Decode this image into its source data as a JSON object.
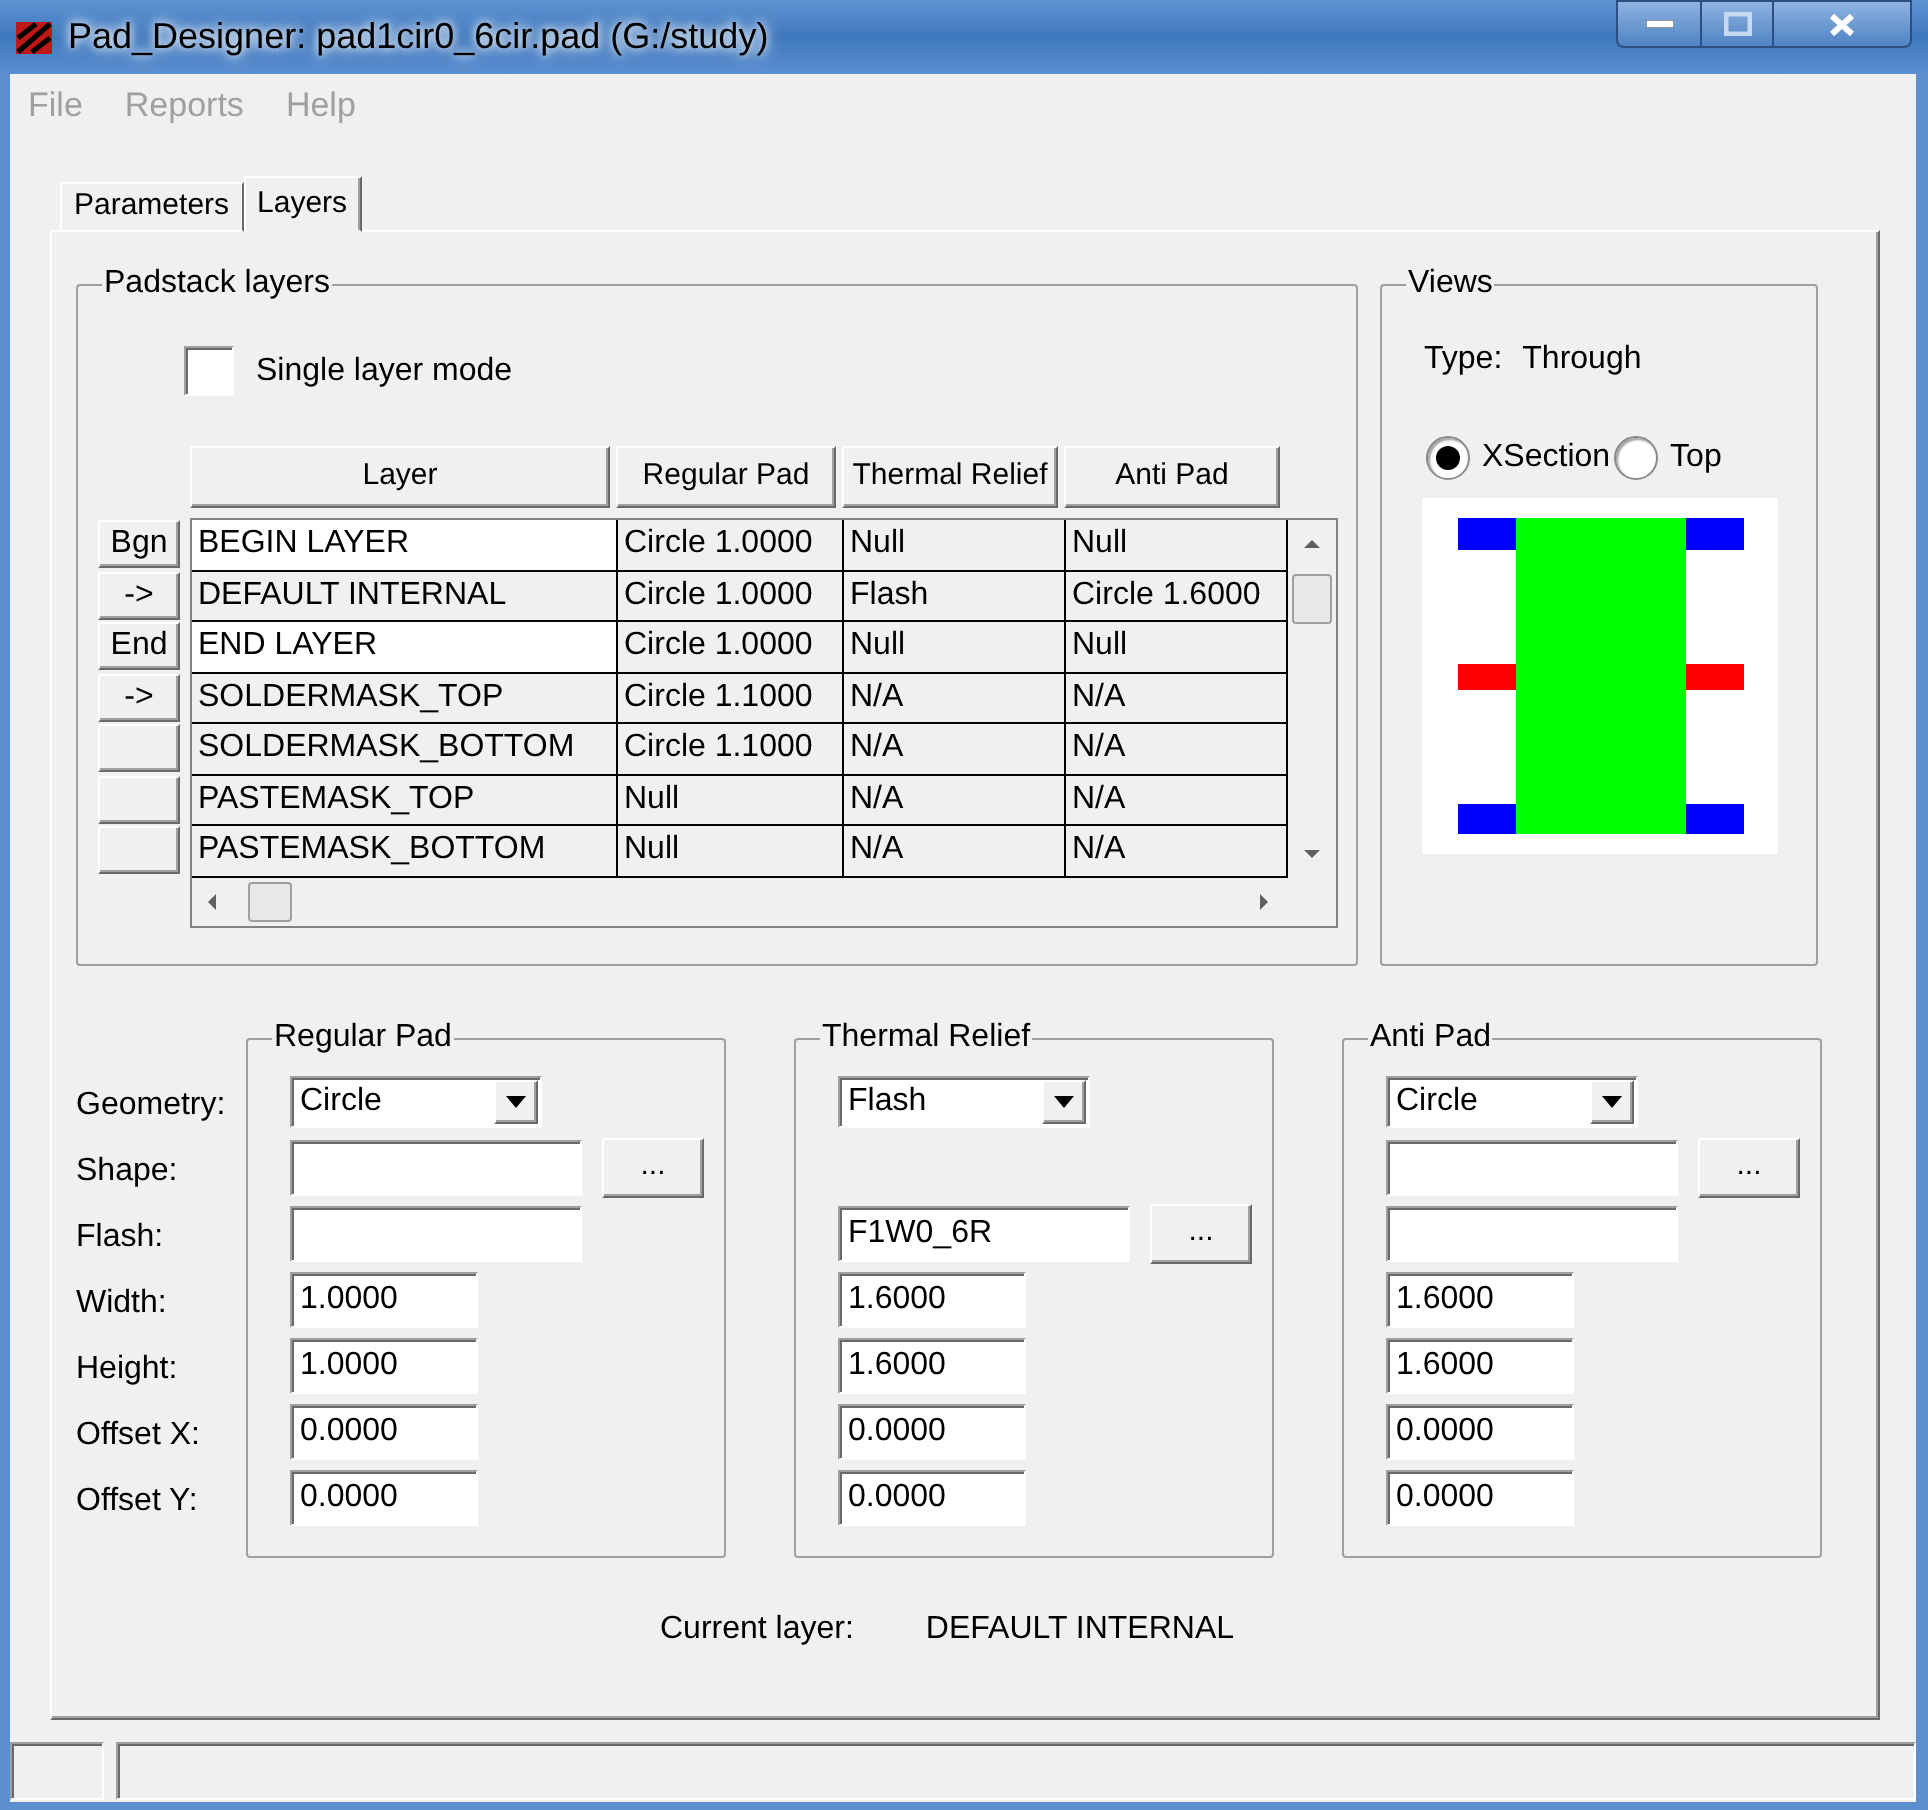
{
  "window": {
    "title": "Pad_Designer: pad1cir0_6cir.pad (G:/study)"
  },
  "menu": [
    {
      "label": "File",
      "disabled": true
    },
    {
      "label": "Reports",
      "disabled": true
    },
    {
      "label": "Help",
      "disabled": true
    }
  ],
  "tabs": [
    {
      "label": "Parameters",
      "selected": false
    },
    {
      "label": "Layers",
      "selected": true
    }
  ],
  "padstack_layers": {
    "title": "Padstack layers",
    "single_layer_mode": {
      "label": "Single layer mode",
      "checked": false
    },
    "columns": [
      "Layer",
      "Regular Pad",
      "Thermal Relief",
      "Anti Pad"
    ],
    "rows": [
      {
        "button": "Bgn",
        "highlighted": true,
        "cells": [
          "BEGIN LAYER",
          "Circle 1.0000",
          "Null",
          "Null"
        ]
      },
      {
        "button": "->",
        "highlighted": false,
        "cells": [
          "DEFAULT INTERNAL",
          "Circle 1.0000",
          "Flash",
          "Circle 1.6000"
        ]
      },
      {
        "button": "End",
        "highlighted": true,
        "cells": [
          "END LAYER",
          "Circle 1.0000",
          "Null",
          "Null"
        ]
      },
      {
        "button": "->",
        "highlighted": false,
        "cells": [
          "SOLDERMASK_TOP",
          "Circle 1.1000",
          "N/A",
          "N/A"
        ]
      },
      {
        "highlighted": false,
        "cells": [
          "SOLDERMASK_BOTTOM",
          "Circle 1.1000",
          "N/A",
          "N/A"
        ]
      },
      {
        "highlighted": false,
        "cells": [
          "PASTEMASK_TOP",
          "Null",
          "N/A",
          "N/A"
        ]
      },
      {
        "highlighted": false,
        "cells": [
          "PASTEMASK_BOTTOM",
          "Null",
          "N/A",
          "N/A"
        ]
      }
    ]
  },
  "views": {
    "title": "Views",
    "type_label": "Type:",
    "type_value": "Through",
    "options": [
      {
        "label": "XSection",
        "selected": true
      },
      {
        "label": "Top",
        "selected": false
      }
    ]
  },
  "field_labels": [
    "Geometry:",
    "Shape:",
    "Flash:",
    "Width:",
    "Height:",
    "Offset X:",
    "Offset Y:"
  ],
  "pad_groups": [
    {
      "title": "Regular Pad",
      "geometry": "Circle",
      "fields": [
        {
          "kind": "wide",
          "button": "..."
        },
        {
          "kind": "wide"
        },
        {
          "kind": "narrow",
          "value": "1.0000"
        },
        {
          "kind": "narrow",
          "value": "1.0000"
        },
        {
          "kind": "narrow",
          "value": "0.0000"
        },
        {
          "kind": "narrow",
          "value": "0.0000"
        }
      ]
    },
    {
      "title": "Thermal Relief",
      "geometry": "Flash",
      "fields": [
        {
          "kind": "none"
        },
        {
          "kind": "wide",
          "value": "F1W0_6R",
          "button": "..."
        },
        {
          "kind": "narrow",
          "value": "1.6000"
        },
        {
          "kind": "narrow",
          "value": "1.6000"
        },
        {
          "kind": "narrow",
          "value": "0.0000"
        },
        {
          "kind": "narrow",
          "value": "0.0000"
        }
      ]
    },
    {
      "title": "Anti Pad",
      "geometry": "Circle",
      "fields": [
        {
          "kind": "wide",
          "button": "..."
        },
        {
          "kind": "wide"
        },
        {
          "kind": "narrow",
          "value": "1.6000"
        },
        {
          "kind": "narrow",
          "value": "1.6000"
        },
        {
          "kind": "narrow",
          "value": "0.0000"
        },
        {
          "kind": "narrow",
          "value": "0.0000"
        }
      ]
    }
  ],
  "current_layer": {
    "label": "Current layer:",
    "value": "DEFAULT INTERNAL"
  }
}
